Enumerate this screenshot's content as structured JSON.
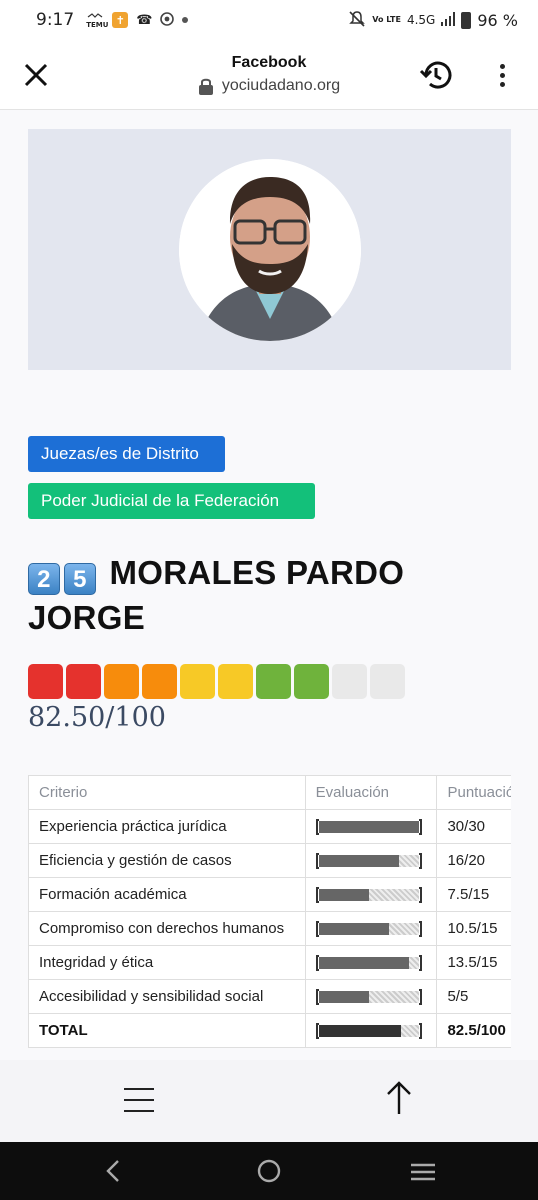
{
  "status_bar": {
    "time": "9:17",
    "temu_label": "TEMU",
    "network": "4.5G",
    "volte": "Vo LTE",
    "battery": "96 %"
  },
  "browser": {
    "title": "Facebook",
    "url": "yociudadano.org",
    "icons": [
      "close-icon",
      "lock-icon",
      "history-icon",
      "more-vert-icon"
    ]
  },
  "profile": {
    "tags": [
      "Juezas/es de Distrito",
      "Poder Judicial de la Federación"
    ],
    "number_keycaps": [
      "2",
      "5"
    ],
    "name": "MORALES PARDO JORGE",
    "rating_squares": [
      "red",
      "red",
      "orange",
      "orange",
      "yellow",
      "yellow",
      "green",
      "green",
      "white",
      "white"
    ],
    "score": "82.50/100"
  },
  "colors": {
    "red": "#e5322d",
    "orange": "#f78c0c",
    "yellow": "#f7c926",
    "green": "#6fb33c",
    "white": "#e9e9e9",
    "tag_blue": "#1d6fd6",
    "tag_green": "#13c07a",
    "score_text": "#3b4a63"
  },
  "table": {
    "headers": [
      "Criterio",
      "Evaluación",
      "Puntuación"
    ],
    "rows": [
      {
        "criterio": "Experiencia práctica jurídica",
        "fill": 1.0,
        "puntuacion": "30/30"
      },
      {
        "criterio": "Eficiencia y gestión de casos",
        "fill": 0.8,
        "puntuacion": "16/20"
      },
      {
        "criterio": "Formación académica",
        "fill": 0.5,
        "puntuacion": "7.5/15"
      },
      {
        "criterio": "Compromiso con derechos humanos",
        "fill": 0.7,
        "puntuacion": "10.5/15"
      },
      {
        "criterio": "Integridad y ética",
        "fill": 0.9,
        "puntuacion": "13.5/15"
      },
      {
        "criterio": "Accesibilidad y sensibilidad social",
        "fill": 0.5,
        "puntuacion": "5/5"
      }
    ],
    "total": {
      "criterio": "TOTAL",
      "fill": 0.825,
      "puntuacion": "82.5/100"
    }
  },
  "bottom_nav": {
    "icons": [
      "menu-icon",
      "arrow-up-icon"
    ]
  },
  "system_nav": {
    "icons": [
      "back-icon",
      "home-icon",
      "recents-icon"
    ]
  }
}
